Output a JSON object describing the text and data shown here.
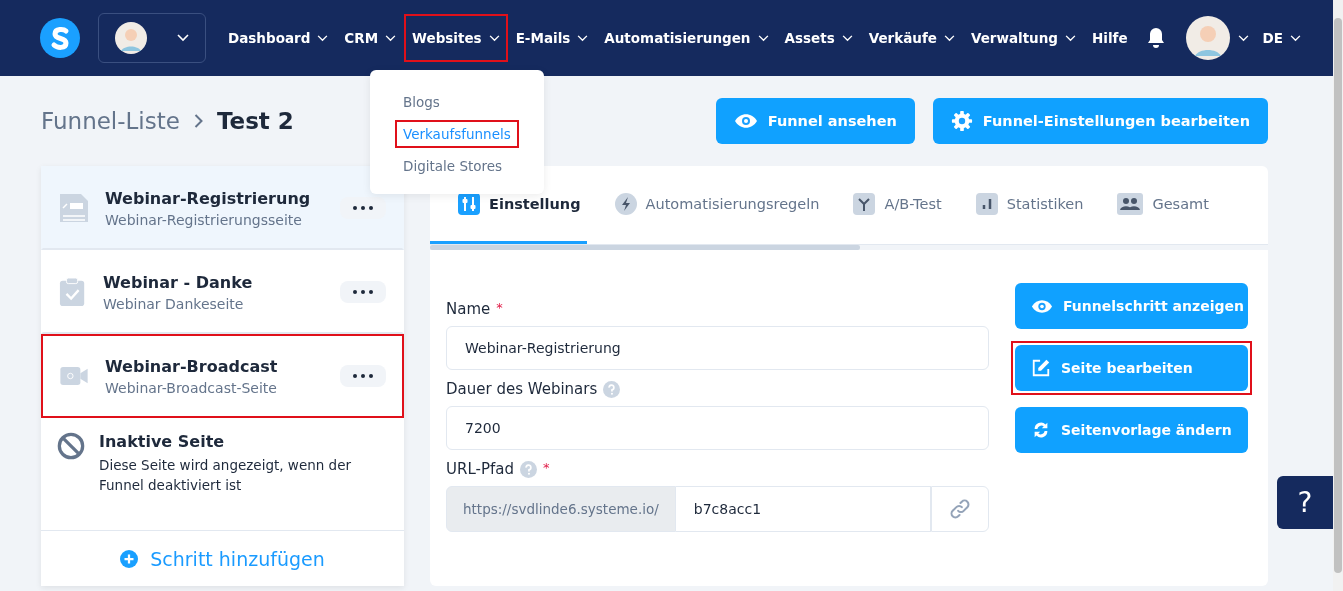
{
  "nav": {
    "items": [
      {
        "label": "Dashboard",
        "caret": true,
        "highlighted": false
      },
      {
        "label": "CRM",
        "caret": true,
        "highlighted": false
      },
      {
        "label": "Websites",
        "caret": true,
        "highlighted": true
      },
      {
        "label": "E-Mails",
        "caret": true,
        "highlighted": false
      },
      {
        "label": "Automatisierungen",
        "caret": true,
        "highlighted": false
      },
      {
        "label": "Assets",
        "caret": true,
        "highlighted": false
      },
      {
        "label": "Verkäufe",
        "caret": true,
        "highlighted": false
      },
      {
        "label": "Verwaltung",
        "caret": true,
        "highlighted": false
      },
      {
        "label": "Hilfe",
        "caret": false,
        "highlighted": false
      }
    ],
    "language": "DE"
  },
  "dropdown": [
    {
      "label": "Blogs",
      "selected": false,
      "highlighted": false
    },
    {
      "label": "Verkaufsfunnels",
      "selected": true,
      "highlighted": true
    },
    {
      "label": "Digitale Stores",
      "selected": false,
      "highlighted": false
    }
  ],
  "breadcrumb": {
    "parent": "Funnel-Liste",
    "current": "Test 2"
  },
  "actions": [
    {
      "label": "Funnel ansehen",
      "kind": "eye"
    },
    {
      "label": "Funnel-Einstellungen bearbeiten",
      "kind": "gear"
    }
  ],
  "steps": [
    {
      "title": "Webinar-Registrierung",
      "subtitle": "Webinar-Registrierungsseite",
      "kind": "form",
      "selected": true,
      "highlighted": false
    },
    {
      "title": "Webinar - Danke",
      "subtitle": "Webinar Dankeseite",
      "kind": "check",
      "selected": false,
      "highlighted": false
    },
    {
      "title": "Webinar-Broadcast",
      "subtitle": "Webinar-Broadcast-Seite",
      "kind": "video",
      "selected": false,
      "highlighted": true
    }
  ],
  "inactive_page": {
    "title": "Inaktive Seite",
    "description": "Diese Seite wird angezeigt, wenn der Funnel deaktiviert ist"
  },
  "add_step": "Schritt hinzufügen",
  "tabs": [
    {
      "label": "Einstellung",
      "kind": "sliders",
      "selected": true
    },
    {
      "label": "Automatisierungsregeln",
      "kind": "bolt",
      "selected": false
    },
    {
      "label": "A/B-Test",
      "kind": "split",
      "selected": false
    },
    {
      "label": "Statistiken",
      "kind": "bars",
      "selected": false
    },
    {
      "label": "Gesamt",
      "kind": "people",
      "selected": false
    }
  ],
  "form": {
    "name": {
      "label": "Name",
      "required_marker": "*",
      "value": "Webinar-Registrierung"
    },
    "duration": {
      "label": "Dauer des Webinars",
      "help": true,
      "value": "7200"
    },
    "url": {
      "label": "URL-Pfad",
      "help": true,
      "required_marker": "*",
      "prefix": "https://svdlinde6.systeme.io/",
      "value": "b7c8acc1"
    }
  },
  "step_buttons": [
    {
      "label": "Funnelschritt anzeigen",
      "kind": "eye",
      "highlighted": false
    },
    {
      "label": "Seite bearbeiten",
      "kind": "edit",
      "highlighted": true
    },
    {
      "label": "Seitenvorlage ändern",
      "kind": "swap",
      "highlighted": false
    }
  ],
  "help_button": "?"
}
